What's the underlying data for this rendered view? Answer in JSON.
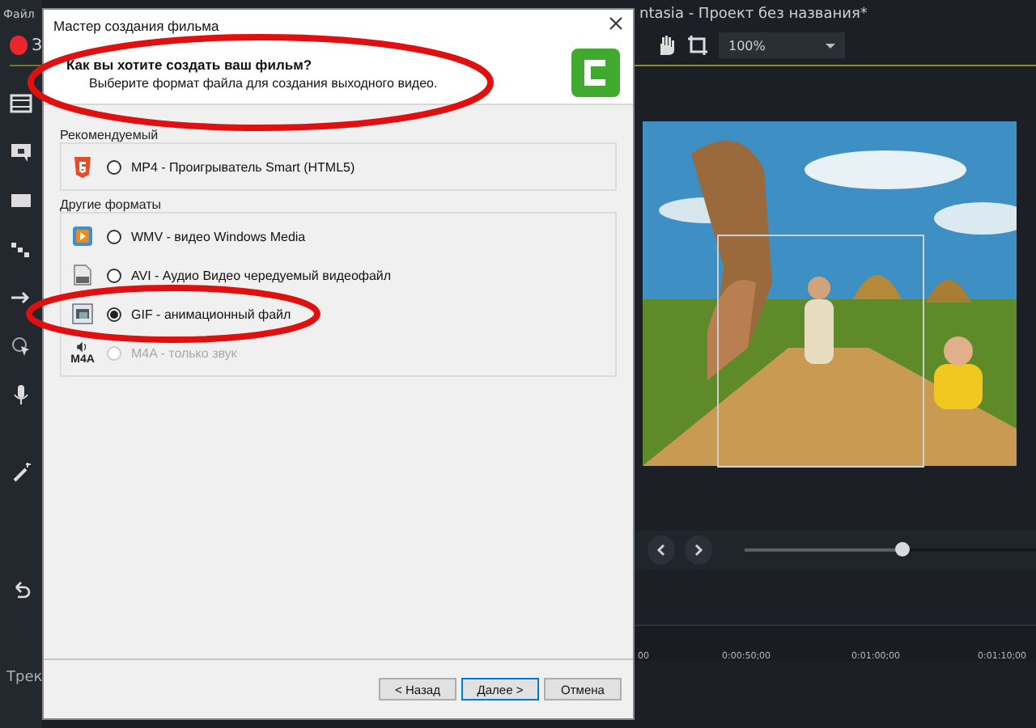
{
  "app": {
    "menu": [
      "Файл"
    ],
    "record_label": "З",
    "title": "ntasia - Проект без названия*",
    "zoom": "100%",
    "playhead": {
      "level": 0.54
    },
    "ruler": [
      "00",
      "0:00:50;00",
      "0:01:00;00",
      "0:01:10;00"
    ],
    "tracks_label": "Трек"
  },
  "dialog": {
    "title": "Мастер создания фильма",
    "question": "Как вы хотите создать ваш фильм?",
    "hint": "Выберите формат файла для создания выходного видео.",
    "groups": [
      {
        "label": "Рекомендуемый",
        "options": [
          {
            "kind": "html5",
            "label": "MP4 - Проигрыватель Smart (HTML5)",
            "selected": false,
            "disabled": false
          }
        ]
      },
      {
        "label": "Другие форматы",
        "options": [
          {
            "kind": "media",
            "label": "WMV - видео Windows Media",
            "selected": false,
            "disabled": false
          },
          {
            "kind": "file",
            "label": "AVI - Аудио Видео чередуемый видеофайл",
            "selected": false,
            "disabled": false
          },
          {
            "kind": "gif",
            "label": "GIF - анимационный файл",
            "selected": true,
            "disabled": false
          },
          {
            "kind": "audio",
            "badge": "M4A",
            "label": "M4A - только звук",
            "selected": false,
            "disabled": true
          }
        ]
      }
    ],
    "buttons": [
      {
        "label": "< Назад",
        "default": false
      },
      {
        "label": "Далее >",
        "default": true
      },
      {
        "label": "Отмена",
        "default": false
      }
    ]
  }
}
